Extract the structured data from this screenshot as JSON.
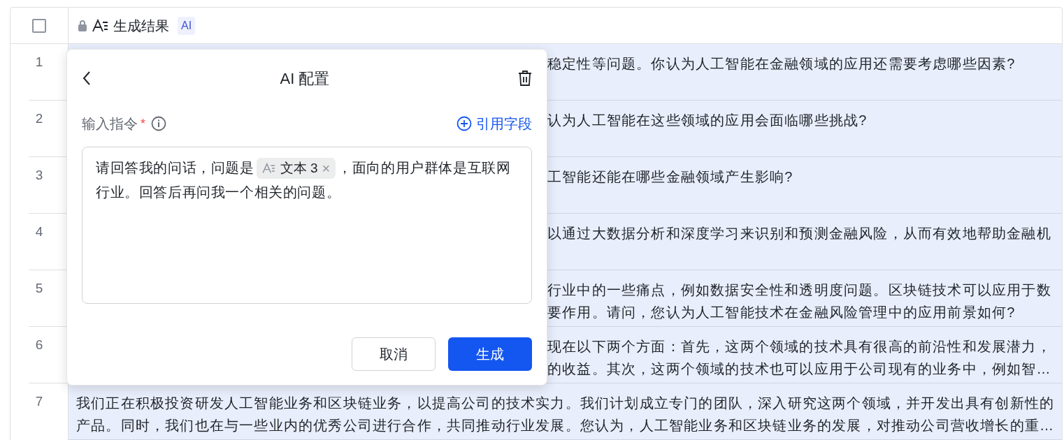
{
  "table": {
    "header": {
      "select_all_checked": false,
      "column_title": "生成结果",
      "badge": "AI"
    },
    "rows": [
      {
        "number": "1",
        "covered": true,
        "lines": [
          "稳定性等问题。你认为人工智能在金融领域的应用还需要考虑哪些因素?"
        ]
      },
      {
        "number": "2",
        "covered": true,
        "lines": [
          "认为人工智能在这些领域的应用会面临哪些挑战?"
        ]
      },
      {
        "number": "3",
        "covered": true,
        "lines": [
          "工智能还能在哪些金融领域产生影响?"
        ]
      },
      {
        "number": "4",
        "covered": true,
        "lines": [
          "以通过大数据分析和深度学习来识别和预测金融风险，从而有效地帮助金融机"
        ]
      },
      {
        "number": "5",
        "covered": true,
        "lines": [
          "行业中的一些痛点，例如数据安全性和透明度问题。区块链技术可以应用于数",
          "要作用。请问，您认为人工智能技术在金融风险管理中的应用前景如何?"
        ]
      },
      {
        "number": "6",
        "covered": true,
        "lines": [
          "现在以下两个方面：首先，这两个领域的技术具有很高的前沿性和发展潜力，",
          "的收益。其次，这两个领域的技术也可以应用于公司现有的业务中，例如智…"
        ]
      },
      {
        "number": "7",
        "covered": false,
        "lines": [
          "我们正在积极投资研发人工智能业务和区块链业务，以提高公司的技术实力。我们计划成立专门的团队，深入研究这两个领域，并开发出具有创新性的",
          "产品。同时，我们也在与一些业内的优秀公司进行合作，共同推动行业发展。您认为，人工智能业务和区块链业务的发展，对推动公司营收增长的重…"
        ]
      }
    ]
  },
  "popover": {
    "title": "AI 配置",
    "label": "输入指令",
    "required": true,
    "required_mark": "*",
    "field_link": "引用字段",
    "prompt": [
      [
        {
          "kind": "text",
          "text": "请回答我的问话，问题是"
        },
        {
          "kind": "chip",
          "text": "文本 3",
          "remove": "×"
        },
        {
          "kind": "text",
          "text": "，面向的用户群体是互联网"
        }
      ],
      [
        {
          "kind": "text",
          "text": "行业。回答后再问我一个相关的问题。"
        }
      ]
    ],
    "buttons": [
      {
        "label": "取消",
        "primary": false
      },
      {
        "label": "生成",
        "primary": true
      }
    ]
  }
}
